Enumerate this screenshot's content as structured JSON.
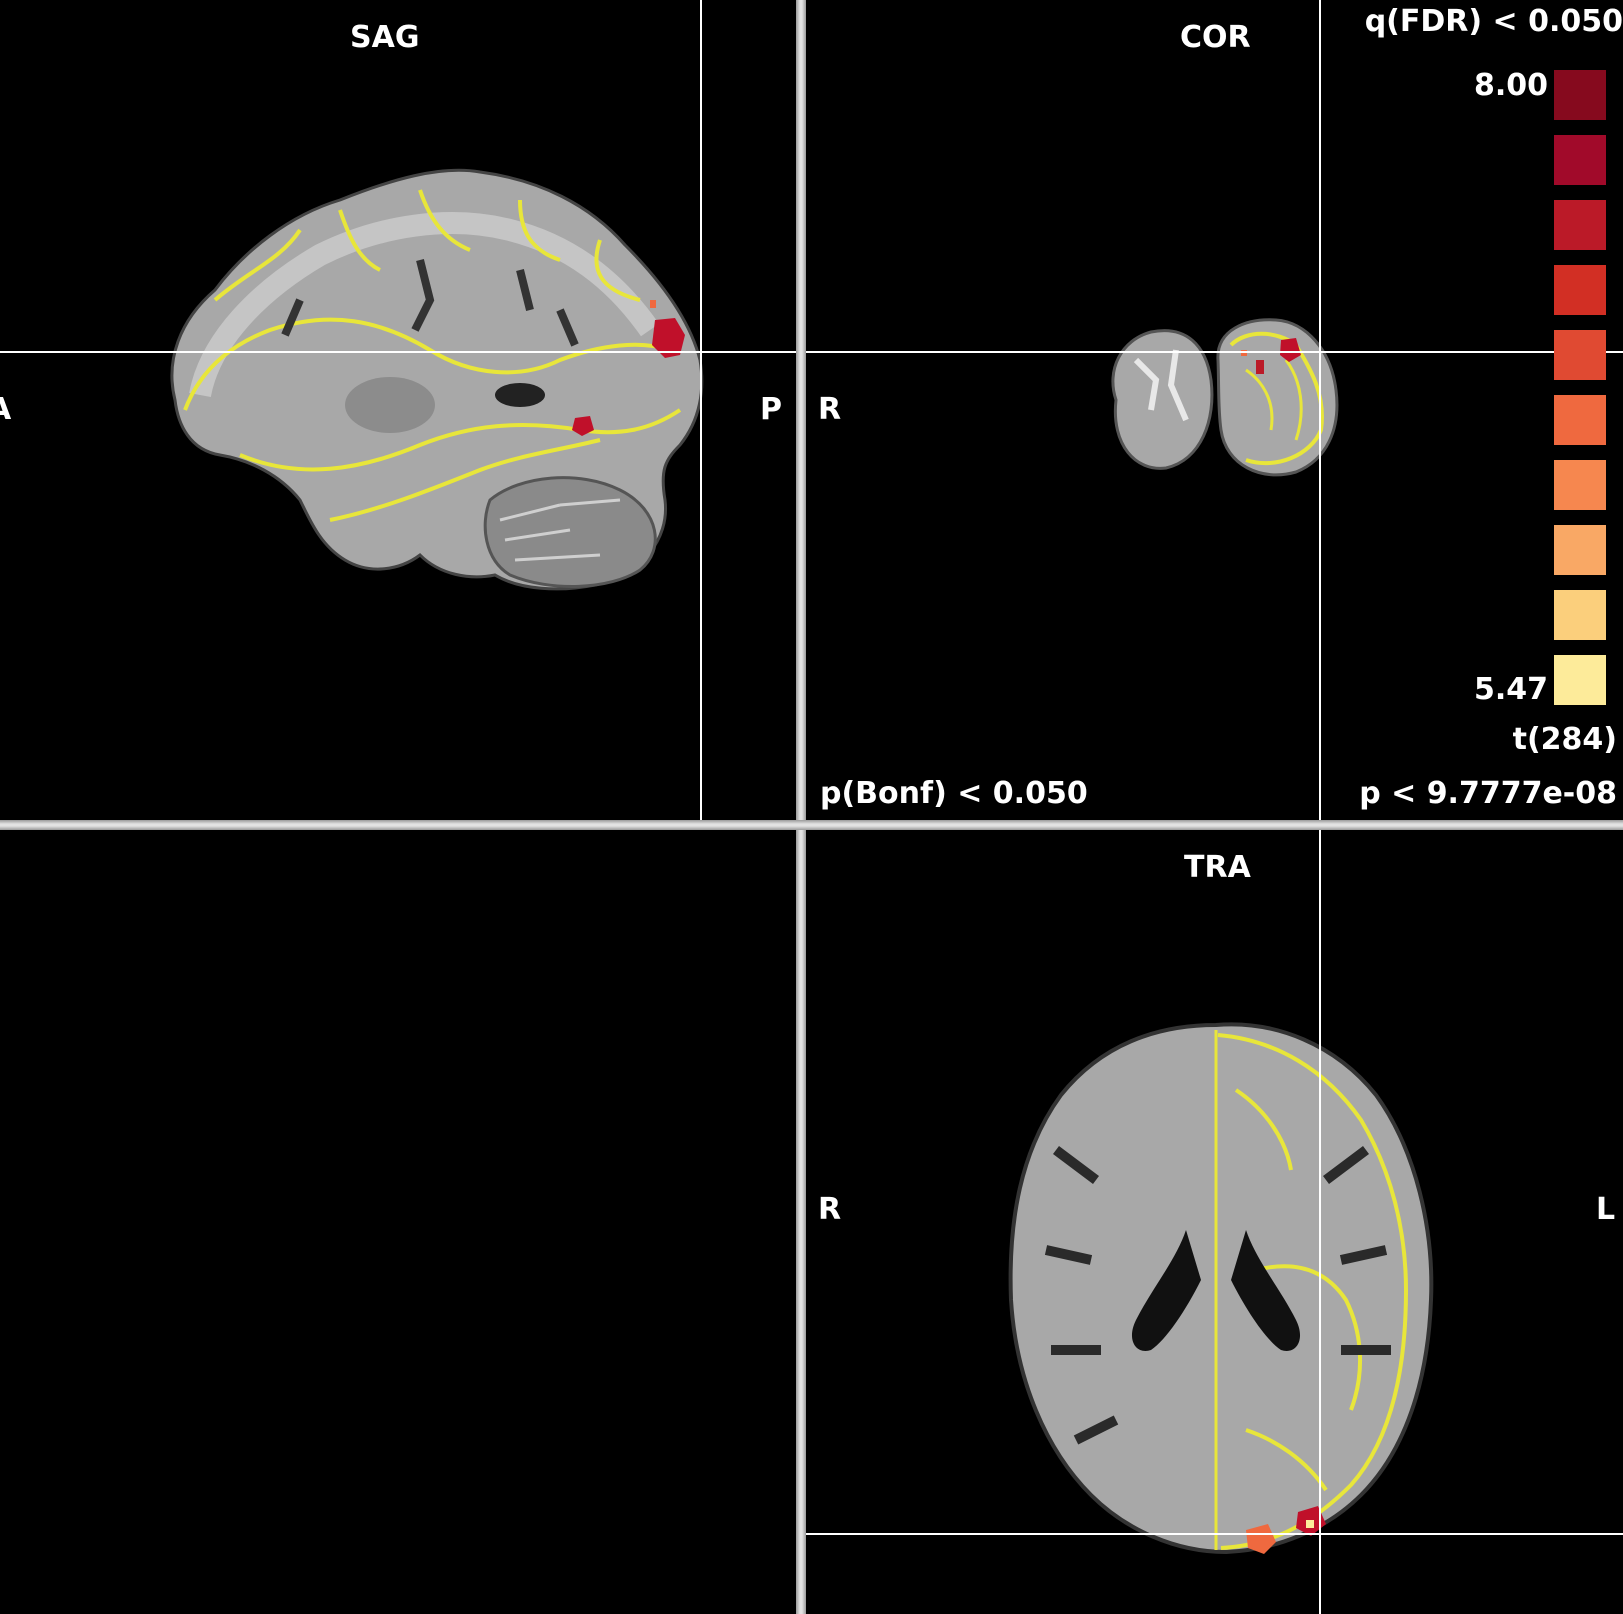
{
  "views": {
    "sag": {
      "title": "SAG",
      "left_label": "A",
      "right_label": "P"
    },
    "cor": {
      "title": "COR",
      "left_label": "R"
    },
    "tra": {
      "title": "TRA",
      "left_label": "R",
      "right_label": "L"
    }
  },
  "legend": {
    "header": "q(FDR) < 0.050",
    "max_value": "8.00",
    "min_value": "5.47",
    "stat_label": "t(284)",
    "p_threshold": "p < 9.7777e-08",
    "bonf_label": "p(Bonf) < 0.050",
    "colors": [
      "#860a1e",
      "#a10a2a",
      "#bb1a28",
      "#d22f24",
      "#e04a32",
      "#ef693f",
      "#f6874f",
      "#f9a865",
      "#fbcf7c",
      "#fdeb9a"
    ]
  },
  "colors": {
    "crosshair": "#ffffff",
    "overlay_outline": "#e8e63a",
    "activation": "#c0102a",
    "background": "#000000",
    "divider": "#d0d0d0"
  }
}
